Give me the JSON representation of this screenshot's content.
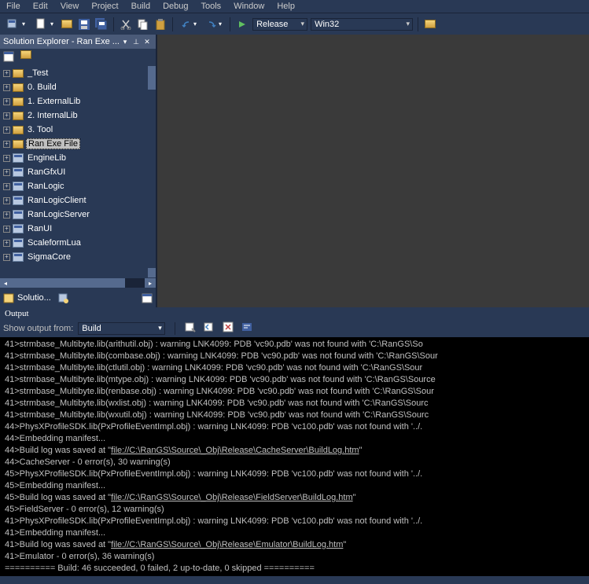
{
  "menubar": [
    "File",
    "Edit",
    "View",
    "Project",
    "Build",
    "Debug",
    "Tools",
    "Window",
    "Help"
  ],
  "toolbar": {
    "config": "Release",
    "platform": "Win32"
  },
  "solution": {
    "title": "Solution Explorer - Ran Exe ...",
    "items": [
      {
        "type": "folder",
        "label": "_Test"
      },
      {
        "type": "folder",
        "label": "0. Build"
      },
      {
        "type": "folder",
        "label": "1. ExternalLib"
      },
      {
        "type": "folder",
        "label": "2. InternalLib"
      },
      {
        "type": "folder",
        "label": "3. Tool"
      },
      {
        "type": "folder",
        "label": "Ran Exe File",
        "selected": true
      },
      {
        "type": "proj",
        "label": "EngineLib"
      },
      {
        "type": "proj",
        "label": "RanGfxUI"
      },
      {
        "type": "proj",
        "label": "RanLogic"
      },
      {
        "type": "proj",
        "label": "RanLogicClient"
      },
      {
        "type": "proj",
        "label": "RanLogicServer"
      },
      {
        "type": "proj",
        "label": "RanUI"
      },
      {
        "type": "proj",
        "label": "ScaleformLua"
      },
      {
        "type": "proj",
        "label": "SigmaCore"
      }
    ],
    "tab": "Solutio..."
  },
  "output": {
    "header": "Output",
    "show_label": "Show output from:",
    "source": "Build",
    "lines": [
      {
        "t": "41>strmbase_Multibyte.lib(arithutil.obj) : warning LNK4099: PDB 'vc90.pdb' was not found with 'C:\\RanGS\\So"
      },
      {
        "t": "41>strmbase_Multibyte.lib(combase.obj) : warning LNK4099: PDB 'vc90.pdb' was not found with 'C:\\RanGS\\Sour"
      },
      {
        "t": "41>strmbase_Multibyte.lib(ctlutil.obj) : warning LNK4099: PDB 'vc90.pdb' was not found with 'C:\\RanGS\\Sour"
      },
      {
        "t": "41>strmbase_Multibyte.lib(mtype.obj) : warning LNK4099: PDB 'vc90.pdb' was not found with 'C:\\RanGS\\Source"
      },
      {
        "t": "41>strmbase_Multibyte.lib(renbase.obj) : warning LNK4099: PDB 'vc90.pdb' was not found with 'C:\\RanGS\\Sour"
      },
      {
        "t": "41>strmbase_Multibyte.lib(wxlist.obj) : warning LNK4099: PDB 'vc90.pdb' was not found with 'C:\\RanGS\\Sourc"
      },
      {
        "t": "41>strmbase_Multibyte.lib(wxutil.obj) : warning LNK4099: PDB 'vc90.pdb' was not found with 'C:\\RanGS\\Sourc"
      },
      {
        "t": "44>PhysXProfileSDK.lib(PxProfileEventImpl.obj) : warning LNK4099: PDB 'vc100.pdb' was not found with '../."
      },
      {
        "t": "44>Embedding manifest..."
      },
      {
        "t": "44>Build log was saved at \"",
        "link": "file://C:\\RanGS\\Source\\_Obj\\Release\\CacheServer\\BuildLog.htm",
        "after": "\""
      },
      {
        "t": "44>CacheServer - 0 error(s), 30 warning(s)"
      },
      {
        "t": "45>PhysXProfileSDK.lib(PxProfileEventImpl.obj) : warning LNK4099: PDB 'vc100.pdb' was not found with '../."
      },
      {
        "t": "45>Embedding manifest..."
      },
      {
        "t": "45>Build log was saved at \"",
        "link": "file://C:\\RanGS\\Source\\_Obj\\Release\\FieldServer\\BuildLog.htm",
        "after": "\""
      },
      {
        "t": "45>FieldServer - 0 error(s), 12 warning(s)"
      },
      {
        "t": "41>PhysXProfileSDK.lib(PxProfileEventImpl.obj) : warning LNK4099: PDB 'vc100.pdb' was not found with '../."
      },
      {
        "t": "41>Embedding manifest..."
      },
      {
        "t": "41>Build log was saved at \"",
        "link": "file://C:\\RanGS\\Source\\_Obj\\Release\\Emulator\\BuildLog.htm",
        "after": "\""
      },
      {
        "t": "41>Emulator - 0 error(s), 36 warning(s)"
      },
      {
        "t": "========== Build: 46 succeeded, 0 failed, 2 up-to-date, 0 skipped =========="
      }
    ]
  }
}
